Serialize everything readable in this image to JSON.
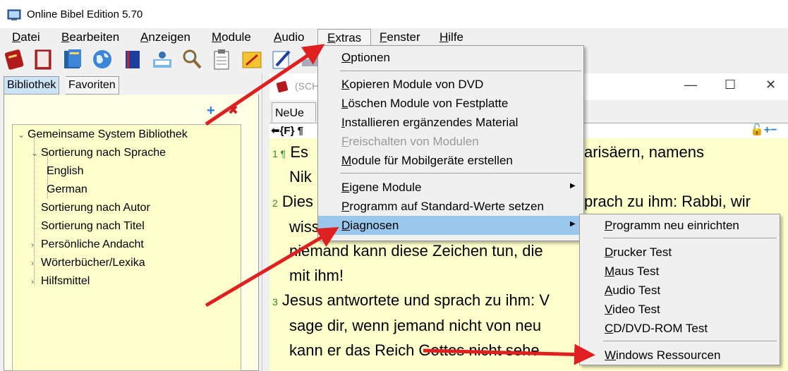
{
  "window": {
    "title": "Online Bibel Edition 5.70"
  },
  "menubar": {
    "items": [
      "Datei",
      "Bearbeiten",
      "Anzeigen",
      "Module",
      "Audio",
      "Extras",
      "Fenster",
      "Hilfe"
    ],
    "active": "Extras"
  },
  "toolbar": {
    "icons": [
      "bible-icon",
      "book-red-icon",
      "book-blue-icon",
      "globe-icon",
      "notebook-icon",
      "reader-icon",
      "search-icon",
      "clipboard-icon",
      "edit-icon",
      "pen-icon",
      "print-icon"
    ]
  },
  "library": {
    "tabs": [
      "Bibliothek",
      "Favoriten"
    ],
    "active_tab": "Bibliothek",
    "tree": [
      {
        "label": "Gemeinsame System Bibliothek",
        "level": 0,
        "toggle": "⌄"
      },
      {
        "label": "Sortierung nach Sprache",
        "level": 1,
        "toggle": "⌄"
      },
      {
        "label": "English",
        "level": 2,
        "toggle": ""
      },
      {
        "label": "German",
        "level": 2,
        "toggle": ""
      },
      {
        "label": "Sortierung nach Autor",
        "level": 1,
        "toggle": ""
      },
      {
        "label": "Sortierung nach Titel",
        "level": 1,
        "toggle": ""
      },
      {
        "label": "Persönliche Andacht",
        "level": 1,
        "toggle": "›"
      },
      {
        "label": "Wörterbücher/Lexika",
        "level": 1,
        "toggle": "›"
      },
      {
        "label": "Hilfsmittel",
        "level": 1,
        "toggle": "›"
      }
    ]
  },
  "document": {
    "title": "(SCH",
    "module_tab": "NeUe",
    "nav": "⬅{F} ¶",
    "lines": [
      {
        "num": "1 ¶",
        "text": "Es",
        "tail": "arisäern, namens"
      },
      {
        "num": "",
        "text": "Nik",
        "tail": ""
      },
      {
        "num": "2",
        "text": "Dies",
        "tail": "prach zu ihm: Rabbi, wir"
      },
      {
        "num": "",
        "text": "wiss",
        "tail": ""
      },
      {
        "num": "",
        "text": "niemand kann diese Zeichen  tun, die",
        "tail": ""
      },
      {
        "num": "",
        "text": "mit ihm!",
        "tail": ""
      },
      {
        "num": "3",
        "text": "Jesus antwortete und sprach zu ihm: V",
        "tail": ""
      },
      {
        "num": "",
        "text": "sage dir,  wenn jemand nicht von neu",
        "tail": ""
      },
      {
        "num": "",
        "text": "kann er das Reich Gottes  nicht sehe",
        "tail": ""
      }
    ]
  },
  "extras_menu": {
    "items": [
      {
        "label": "Optionen",
        "enabled": true,
        "submenu": false
      },
      {
        "label": "Kopieren Module von DVD",
        "enabled": true,
        "submenu": false
      },
      {
        "label": "Löschen Module von Festplatte",
        "enabled": true,
        "submenu": false
      },
      {
        "label": "Installieren ergänzendes Material",
        "enabled": true,
        "submenu": false
      },
      {
        "label": "Freischalten von Modulen",
        "enabled": false,
        "submenu": false
      },
      {
        "label": "Module für Mobilgeräte erstellen",
        "enabled": true,
        "submenu": false
      },
      {
        "label": "Eigene Module",
        "enabled": true,
        "submenu": true
      },
      {
        "label": "Programm auf Standard-Werte setzen",
        "enabled": true,
        "submenu": false
      },
      {
        "label": "Diagnosen",
        "enabled": true,
        "submenu": true,
        "highlighted": true
      }
    ]
  },
  "diagnosen_menu": {
    "items": [
      "Programm neu einrichten",
      "Drucker Test",
      "Maus Test",
      "Audio Test",
      "Video Test",
      "CD/DVD-ROM Test",
      "Windows Ressourcen"
    ]
  },
  "colors": {
    "highlight": "#9ac8ed",
    "annotation_arrow": "#e02020",
    "text_bg": "#ffffcc"
  }
}
